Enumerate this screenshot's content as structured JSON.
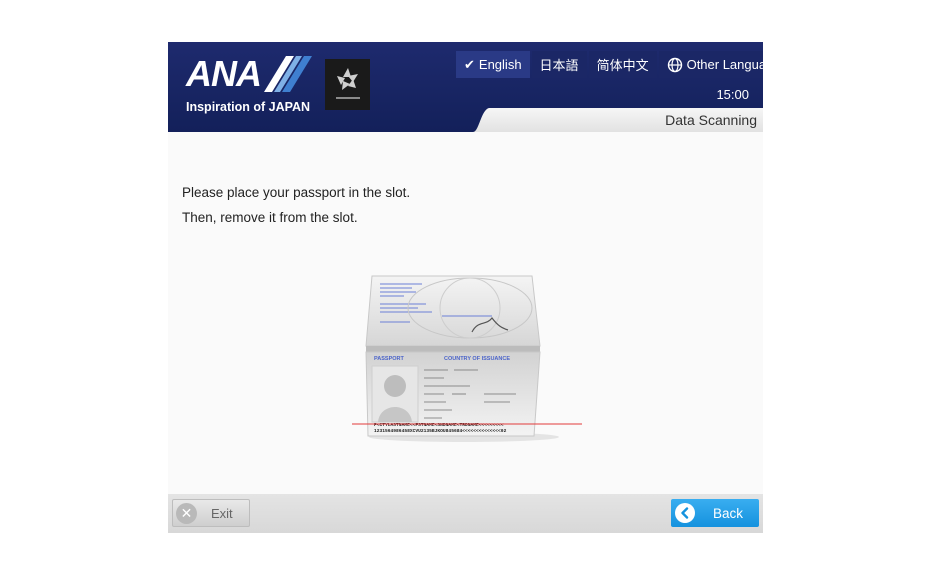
{
  "brand": {
    "logo_text": "ANA",
    "tagline": "Inspiration of JAPAN",
    "partner_logo": "STAR ALLIANCE"
  },
  "languages": [
    {
      "label": "English",
      "selected": true
    },
    {
      "label": "日本語",
      "selected": false
    },
    {
      "label": "简体中文",
      "selected": false
    },
    {
      "label": "Other Language",
      "selected": false
    }
  ],
  "clock": "15:00",
  "breadcrumb": "Data Scanning",
  "instructions": {
    "line1": "Please place your passport in the slot.",
    "line2": "Then, remove it from the slot."
  },
  "passport_illustration": {
    "heading_left": "PASSPORT",
    "heading_right": "COUNTRY OF ISSUANCE",
    "mrz_line1": "P<CTYLASTNAME<<FSTNAME<SNDNAME<TRDNAME<<<<<<<<<",
    "mrz_line2": "1231564986458XCVU2135BJKOU845684<<<<<<<<<<<<<<02"
  },
  "footer": {
    "exit_label": "Exit",
    "back_label": "Back"
  },
  "colors": {
    "header_navy": "#182563",
    "back_blue": "#1592de",
    "scan_line_red": "#e23b3b"
  }
}
